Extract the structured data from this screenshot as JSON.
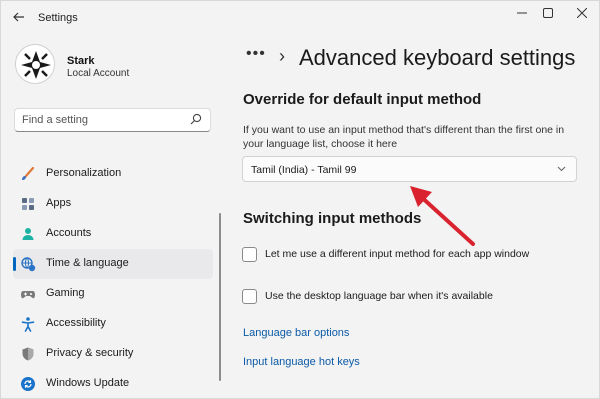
{
  "window": {
    "app_title": "Settings",
    "back_icon": "arrow-left-icon",
    "controls": {
      "minimize_icon": "minimize-icon",
      "maximize_icon": "maximize-icon",
      "close_icon": "close-icon"
    }
  },
  "user": {
    "name": "Stark",
    "account_type": "Local Account"
  },
  "search": {
    "placeholder": "Find a setting",
    "icon": "search-icon"
  },
  "sidebar": {
    "items": [
      {
        "label": "Personalization",
        "icon": "brush-icon",
        "color": "#e0793a"
      },
      {
        "label": "Apps",
        "icon": "apps-icon",
        "color": "#5a6b84"
      },
      {
        "label": "Accounts",
        "icon": "person-icon",
        "color": "#1db3a4"
      },
      {
        "label": "Time & language",
        "icon": "globe-clock-icon",
        "color": "#2b73c6",
        "active": true
      },
      {
        "label": "Gaming",
        "icon": "gamepad-icon",
        "color": "#7b7b7b"
      },
      {
        "label": "Accessibility",
        "icon": "accessibility-icon",
        "color": "#1a73c9"
      },
      {
        "label": "Privacy & security",
        "icon": "shield-icon",
        "color": "#6d6d6d"
      },
      {
        "label": "Windows Update",
        "icon": "update-icon",
        "color": "#1a73c9"
      }
    ]
  },
  "breadcrumb": {
    "overflow": "•••",
    "separator": "›"
  },
  "page": {
    "title": "Advanced keyboard settings",
    "override_section": {
      "heading": "Override for default input method",
      "description": "If you want to use an input method that's different than the first one in your language list, choose it here",
      "dropdown_value": "Tamil (India) - Tamil 99",
      "dropdown_icon": "chevron-down-icon"
    },
    "switching_section": {
      "heading": "Switching input methods",
      "checkboxes": [
        {
          "label": "Let me use a different input method for each app window",
          "checked": false
        },
        {
          "label": "Use the desktop language bar when it's available",
          "checked": false
        }
      ],
      "links": [
        "Language bar options",
        "Input language hot keys"
      ]
    }
  },
  "annotation": {
    "arrow_color": "#d9232e"
  },
  "accent_color": "#0067c0"
}
